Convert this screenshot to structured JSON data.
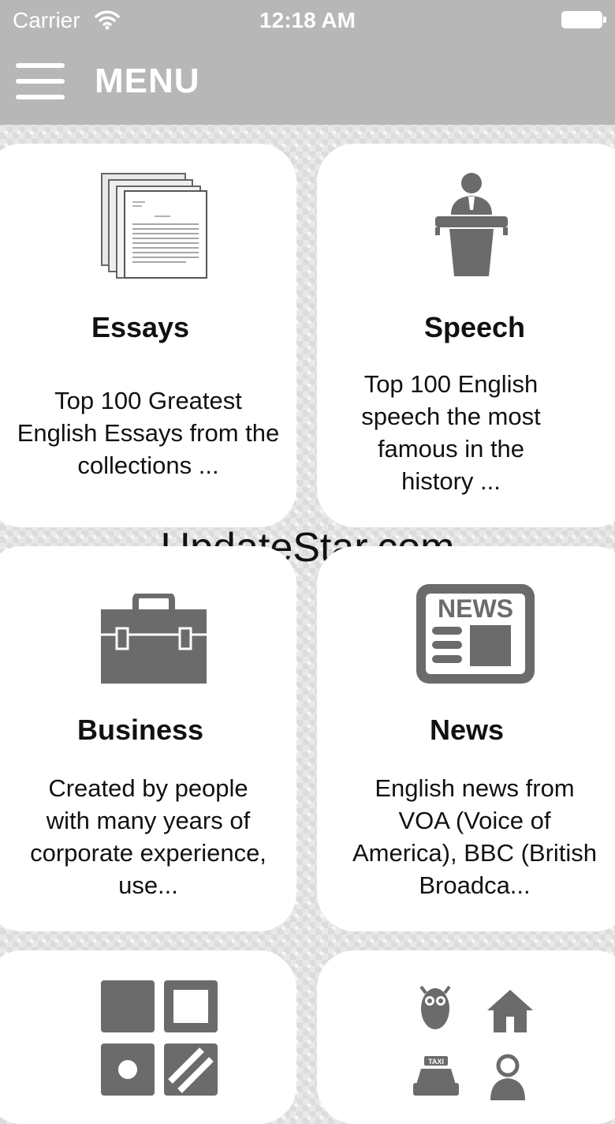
{
  "status_bar": {
    "carrier": "Carrier",
    "time": "12:18 AM"
  },
  "nav": {
    "title": "MENU",
    "menu_icon": "hamburger-menu-icon"
  },
  "cards": [
    {
      "title": "Essays",
      "description": "Top 100 Greatest English Essays from the collections ...",
      "icon": "documents-stack-icon"
    },
    {
      "title": "Speech",
      "description": "Top 100 English speech the most famous in the history ...",
      "icon": "speaker-podium-icon"
    },
    {
      "title": "Business",
      "description": "Created by people with many years of corporate experience, use...",
      "icon": "briefcase-icon"
    },
    {
      "title": "News",
      "description": "English news from VOA (Voice of America), BBC (British Broadca...",
      "icon": "newspaper-icon",
      "icon_text": "NEWS"
    },
    {
      "icon": "grid-tiles-icon"
    },
    {
      "icon": "vocabulary-pictures-icon",
      "icon_text": "TAXI"
    }
  ],
  "watermark": "UpdateStar.com",
  "colors": {
    "bar": "#b7b7b7",
    "icon": "#6b6b6b",
    "card": "#ffffff"
  }
}
